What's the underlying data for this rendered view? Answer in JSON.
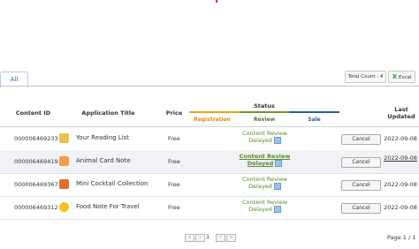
{
  "tabs": [
    {
      "label": "All"
    }
  ],
  "toolbar": {
    "total_count": "Total Count : 4",
    "excel_label": "Excel"
  },
  "table": {
    "headers": {
      "content_id": "Content ID",
      "app_title": "Application Title",
      "price": "Price",
      "status": "Status",
      "registration": "Registration",
      "review": "Review",
      "sale": "Sale",
      "last_updated": "Last Updated"
    },
    "status_colors": {
      "registration": "#f0a020",
      "review": "#6a9a2a",
      "sale": "#2a5aa8"
    },
    "rows": [
      {
        "id": "000006469233",
        "title": "Your Reading List",
        "price": "Free",
        "status": "Content Review Delayed",
        "action": "Cancel",
        "date": "2022-09-08",
        "icon": "book-icon",
        "icon_color": "#e8c24a"
      },
      {
        "id": "000006469419",
        "title": "Animal Card Note",
        "price": "Free",
        "status": "Content Review Delayed",
        "action": "Cancel",
        "date": "2022-09-08",
        "icon": "paw-icon",
        "icon_color": "#f0a040"
      },
      {
        "id": "000006469367",
        "title": "Mini Cocktail Collection",
        "price": "Free",
        "status": "Content Review Delayed",
        "action": "Cancel",
        "date": "2022-09-08",
        "icon": "cocktail-icon",
        "icon_color": "#e07030"
      },
      {
        "id": "000006469312",
        "title": "Food Note For Travel",
        "price": "Free",
        "status": "Content Review Delayed",
        "action": "Cancel",
        "date": "2022-09-08",
        "icon": "food-icon",
        "icon_color": "#f2c020"
      }
    ]
  },
  "pagination": {
    "current": "1",
    "info": "Page 1 / 1"
  }
}
